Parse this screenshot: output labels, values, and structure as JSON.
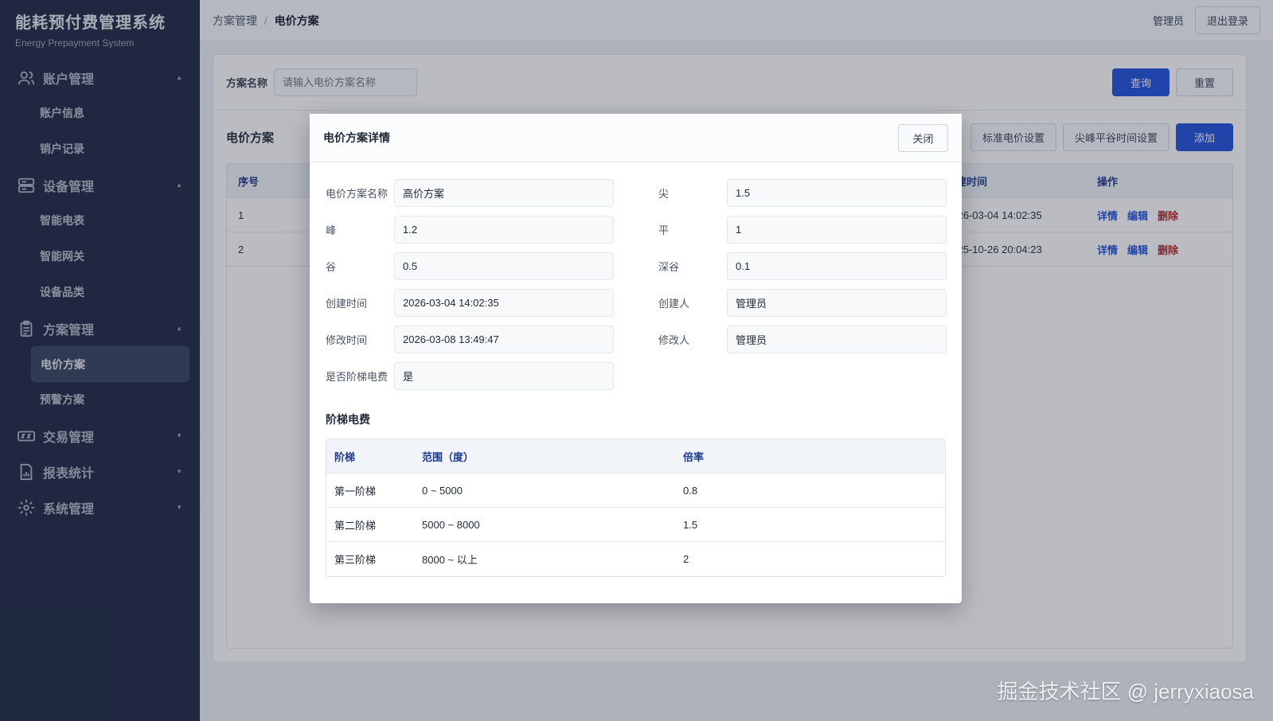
{
  "brand": {
    "title": "能耗预付费管理系统",
    "subtitle": "Energy Prepayment System"
  },
  "sidebar": [
    {
      "label": "账户管理",
      "icon": "users-icon",
      "expanded": true,
      "items": [
        "账户信息",
        "销户记录"
      ]
    },
    {
      "label": "设备管理",
      "icon": "server-icon",
      "expanded": true,
      "items": [
        "智能电表",
        "智能网关",
        "设备品类"
      ]
    },
    {
      "label": "方案管理",
      "icon": "clipboard-icon",
      "expanded": true,
      "items": [
        "电价方案",
        "预警方案"
      ]
    },
    {
      "label": "交易管理",
      "icon": "wallet-icon",
      "expanded": false,
      "items": []
    },
    {
      "label": "报表统计",
      "icon": "report-icon",
      "expanded": false,
      "items": []
    },
    {
      "label": "系统管理",
      "icon": "gear-icon",
      "expanded": false,
      "items": []
    }
  ],
  "header": {
    "crumb_parent": "方案管理",
    "crumb_sep": "/",
    "crumb_current": "电价方案",
    "user": "管理员",
    "logout": "退出登录"
  },
  "filter": {
    "label": "方案名称",
    "placeholder": "请输入电价方案名称",
    "query": "查询",
    "reset": "重置"
  },
  "table": {
    "title": "电价方案",
    "btn_standard": "标准电价设置",
    "btn_time": "尖峰平谷时间设置",
    "btn_add": "添加",
    "headers": {
      "index": "序号",
      "created": "创建时间",
      "ops": "操作"
    },
    "rows": [
      {
        "index": "1",
        "created": "2026-03-04 14:02:35"
      },
      {
        "index": "2",
        "created": "2025-10-26 20:04:23"
      }
    ],
    "ops": {
      "detail": "详情",
      "edit": "编辑",
      "delete": "删除"
    }
  },
  "modal": {
    "title": "电价方案详情",
    "close": "关闭",
    "fields": [
      {
        "label": "电价方案名称",
        "value": "高价方案"
      },
      {
        "label": "尖",
        "value": "1.5"
      },
      {
        "label": "峰",
        "value": "1.2"
      },
      {
        "label": "平",
        "value": "1"
      },
      {
        "label": "谷",
        "value": "0.5"
      },
      {
        "label": "深谷",
        "value": "0.1"
      },
      {
        "label": "创建时间",
        "value": "2026-03-04 14:02:35"
      },
      {
        "label": "创建人",
        "value": "管理员"
      },
      {
        "label": "修改时间",
        "value": "2026-03-08 13:49:47"
      },
      {
        "label": "修改人",
        "value": "管理员"
      },
      {
        "label": "是否阶梯电费",
        "value": "是"
      }
    ],
    "tier_title": "阶梯电费",
    "tier_headers": {
      "tier": "阶梯",
      "range": "范围（度）",
      "rate": "倍率"
    },
    "tiers": [
      {
        "tier": "第一阶梯",
        "range": "0 ~ 5000",
        "rate": "0.8"
      },
      {
        "tier": "第二阶梯",
        "range": "5000 ~ 8000",
        "rate": "1.5"
      },
      {
        "tier": "第三阶梯",
        "range": "8000 ~ 以上",
        "rate": "2"
      }
    ]
  },
  "watermark": "掘金技术社区 @ jerryxiaosa"
}
